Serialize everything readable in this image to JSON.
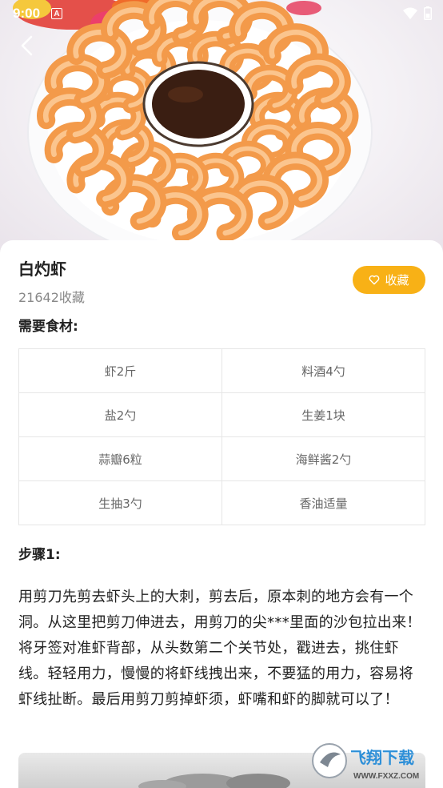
{
  "status_bar": {
    "time": "9:00",
    "notification_letter": "A"
  },
  "recipe": {
    "title": "白灼虾",
    "favorites_count": "21642收藏",
    "favorite_button": "收藏",
    "ingredients_heading": "需要食材:",
    "ingredients": [
      [
        "虾2斤",
        "料酒4勺"
      ],
      [
        "盐2勺",
        "生姜1块"
      ],
      [
        "蒜瓣6粒",
        "海鲜酱2勺"
      ],
      [
        "生抽3勺",
        "香油适量"
      ]
    ],
    "steps": [
      {
        "heading": "步骤1:",
        "text": "用剪刀先剪去虾头上的大刺，剪去后，原本刺的地方会有一个洞。从这里把剪刀伸进去，用剪刀的尖***里面的沙包拉出来！将牙签对准虾背部，从头数第二个关节处，戳进去，挑住虾线。轻轻用力，慢慢的将虾线拽出来，不要猛的用力，容易将虾线扯断。最后用剪刀剪掉虾须，虾嘴和虾的脚就可以了！"
      }
    ]
  },
  "watermark": {
    "brand": "飞翔下载",
    "url": "WWW.FXXZ.COM"
  },
  "colors": {
    "accent": "#f8b116",
    "shrimp": "#f39a4a",
    "sauce": "#3a1e12"
  },
  "icons": {
    "back": "chevron-left-icon",
    "favorite": "heart-outline-icon"
  }
}
